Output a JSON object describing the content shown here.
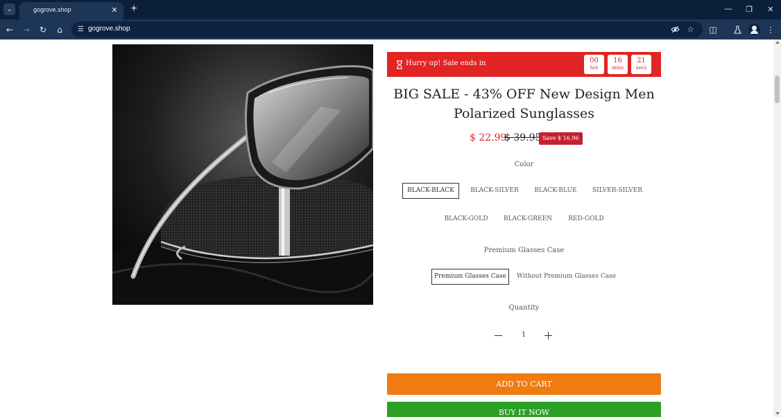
{
  "browser": {
    "tab_title": "gogrove.shop",
    "url": "gogrove.shop",
    "icons": [
      "tab-search-icon",
      "close-icon",
      "plus-icon",
      "minimize-icon",
      "restore-icon",
      "close-window-icon",
      "back-icon",
      "forward-icon",
      "reload-icon",
      "home-icon",
      "site-info-icon",
      "eye-off-icon",
      "star-icon",
      "extensions-icon",
      "labs-icon",
      "profile-icon",
      "menu-icon"
    ]
  },
  "banner": {
    "text": "Hurry up! Sale ends in",
    "timer": [
      {
        "value": "00",
        "unit": "hrs"
      },
      {
        "value": "16",
        "unit": "mins"
      },
      {
        "value": "21",
        "unit": "secs"
      }
    ],
    "color": "#e12424"
  },
  "product": {
    "title": "BIG SALE - 43% OFF New Design Men Polarized Sunglasses",
    "price": "$ 22.99",
    "compare_price": "$ 39.95",
    "save_badge": "Save $ 16.96"
  },
  "color_option": {
    "label": "Color",
    "selected": "BLACK-BLACK",
    "values": [
      "BLACK-BLACK",
      "BLACK-SILVER",
      "BLACK-BLUE",
      "SILVER-SILVER",
      "BLACK-GOLD",
      "BLACK-GREEN",
      "RED-GOLD"
    ]
  },
  "case_option": {
    "label": "Premium Glasses Case",
    "selected": "Premium Glasses Case",
    "values": [
      "Premium Glasses Case",
      "Without Premium Glasses Case"
    ]
  },
  "quantity": {
    "label": "Quantity",
    "value": "1"
  },
  "actions": {
    "add_to_cart": "ADD TO CART",
    "buy_now": "BUY IT NOW",
    "add_to_cart_color": "#ef7b11",
    "buy_now_color": "#2aa125"
  }
}
